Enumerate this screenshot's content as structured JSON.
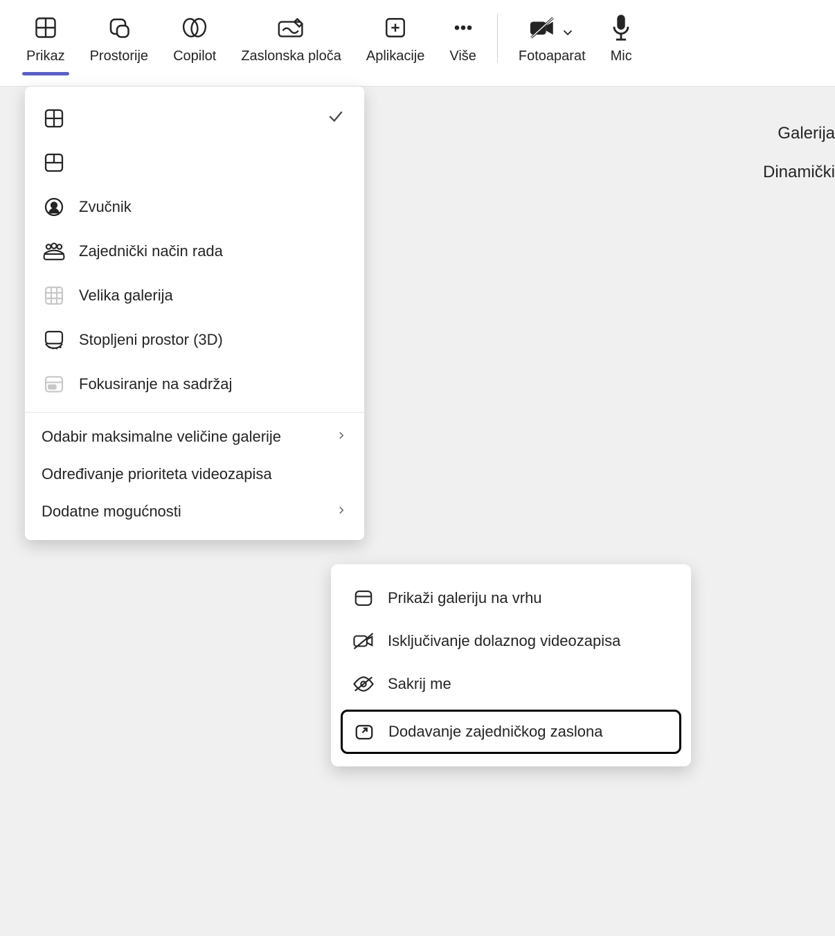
{
  "toolbar": {
    "view": "Prikaz",
    "rooms": "Prostorije",
    "copilot": "Copilot",
    "whiteboard": "Zaslonska ploča",
    "apps": "Aplikacije",
    "more": "Više",
    "camera": "Fotoaparat",
    "mic": "Mic"
  },
  "side": {
    "gallery": "Galerija",
    "dynamic": "Dinamički"
  },
  "dropdown": {
    "speaker": "Zvučnik",
    "together": "Zajednički način rada",
    "large_gallery": "Velika galerija",
    "immersive3d": "Stopljeni prostor (3D)",
    "focus_content": "Fokusiranje na sadržaj",
    "max_gallery": "Odabir maksimalne veličine galerije",
    "prioritize_video": "Određivanje prioriteta videozapisa",
    "more_options": "Dodatne mogućnosti"
  },
  "submenu": {
    "gallery_top": "Prikaži galeriju na vrhu",
    "disable_incoming": "Isključivanje dolaznog videozapisa",
    "hide_me": "Sakrij me",
    "pop_out": "Dodavanje zajedničkog zaslona"
  }
}
